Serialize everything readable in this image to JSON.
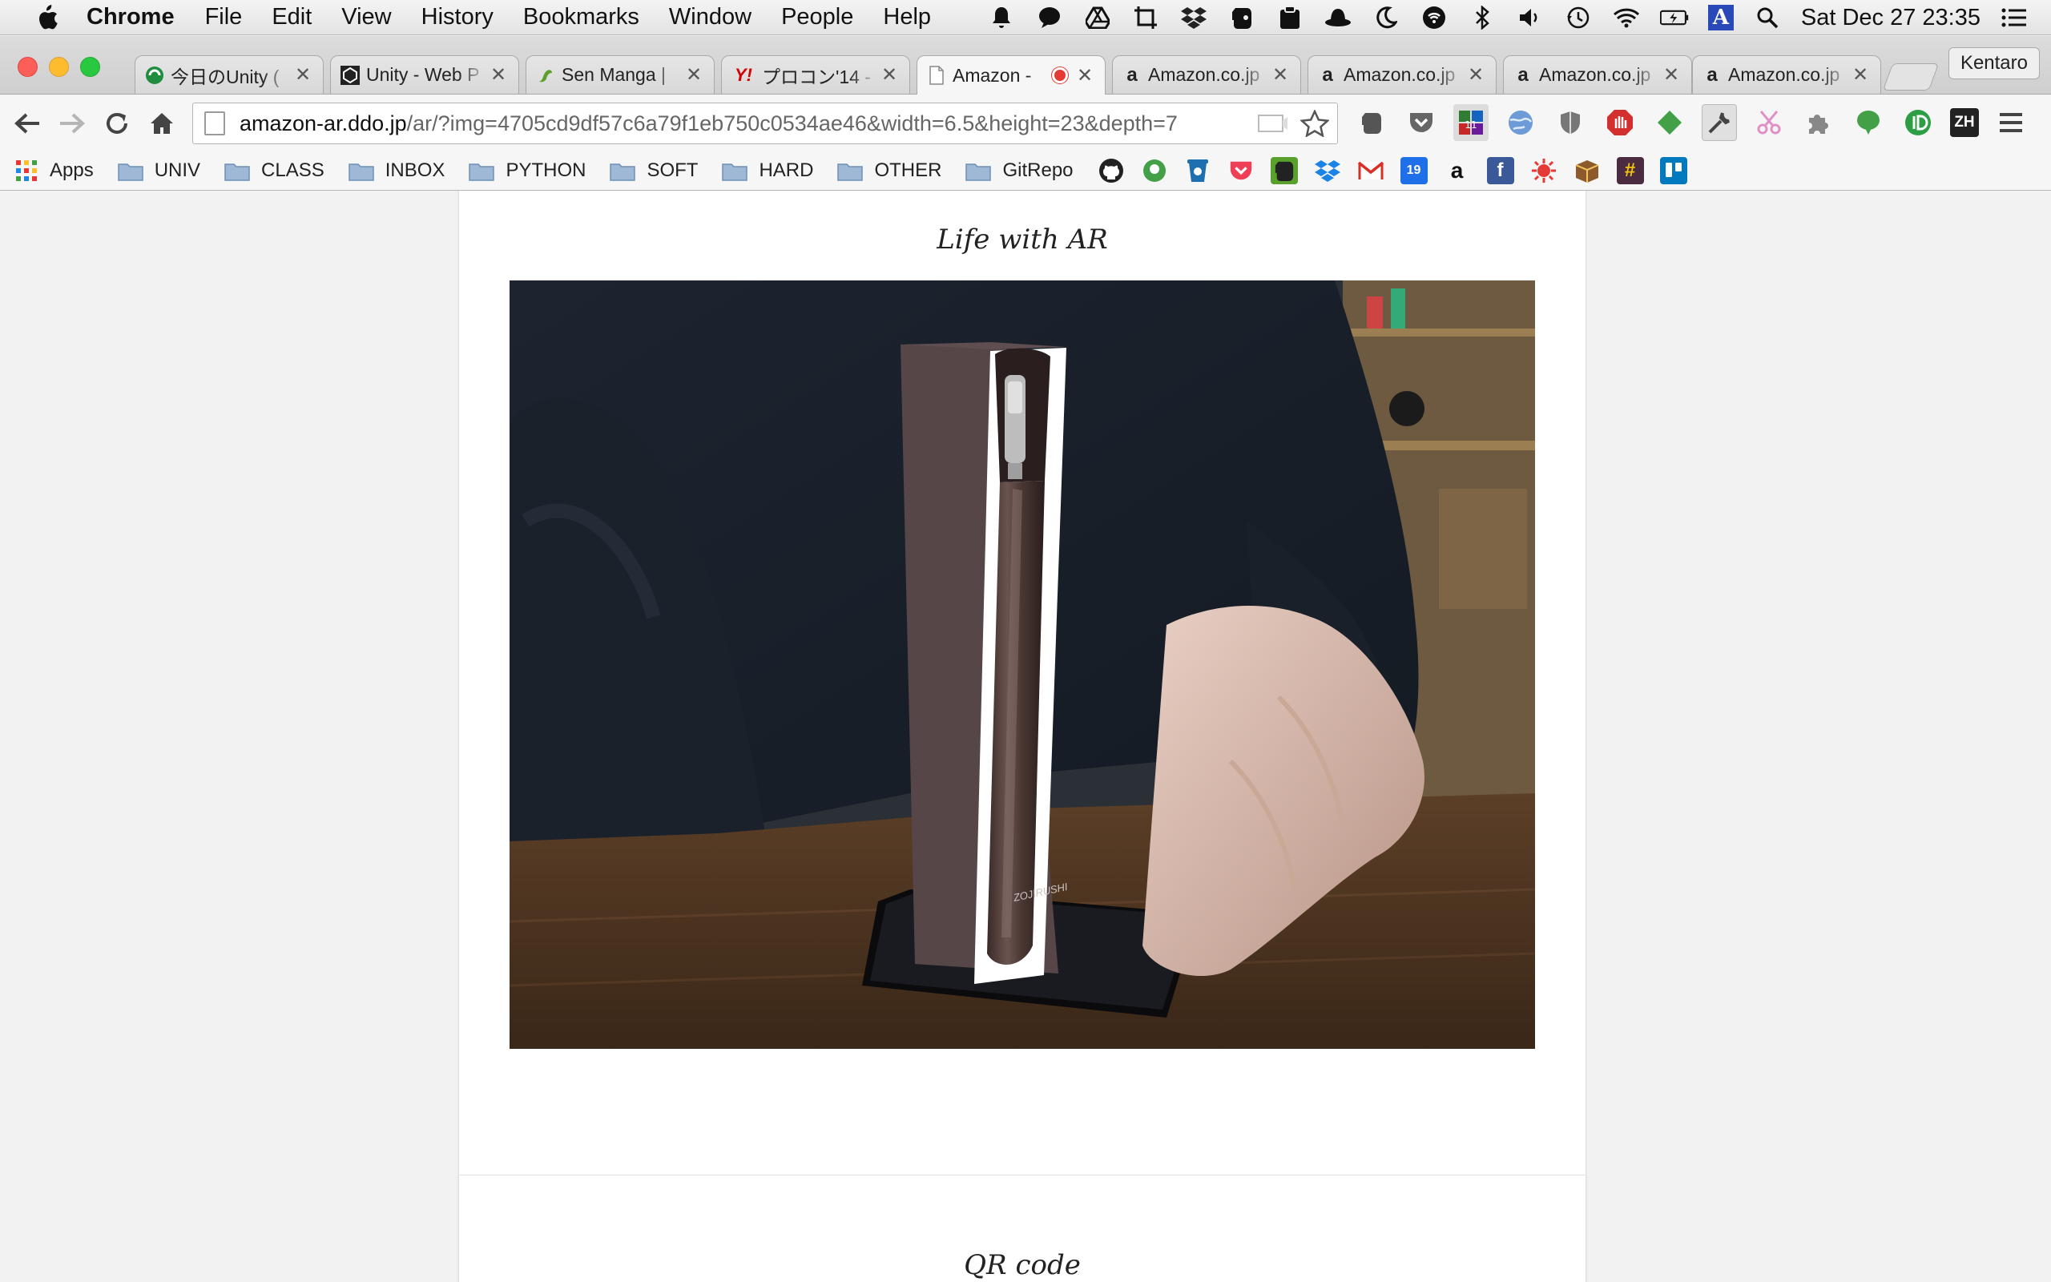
{
  "menubar": {
    "app_name": "Chrome",
    "items": [
      "File",
      "Edit",
      "View",
      "History",
      "Bookmarks",
      "Window",
      "People",
      "Help"
    ],
    "clock": "Sat Dec 27  23:35",
    "input_source": "A"
  },
  "tabs": [
    {
      "title": "今日のUnity (",
      "favicon": "unity-green-icon"
    },
    {
      "title": "Unity - Web P",
      "favicon": "unity-icon"
    },
    {
      "title": "Sen Manga |",
      "favicon": "senmanga-icon"
    },
    {
      "title": "プロコン'14 -",
      "favicon": "yahoo-icon"
    },
    {
      "title": "Amazon -",
      "favicon": "page-icon",
      "active": true,
      "recording": true
    },
    {
      "title": "Amazon.co.jp",
      "favicon": "amazon-icon"
    },
    {
      "title": "Amazon.co.jp",
      "favicon": "amazon-icon"
    },
    {
      "title": "Amazon.co.jp",
      "favicon": "amazon-icon"
    },
    {
      "title": "Amazon.co.jp",
      "favicon": "amazon-icon"
    }
  ],
  "profile_name": "Kentaro",
  "toolbar": {
    "url_host": "amazon-ar.ddo.jp",
    "url_rest": "/ar/?img=4705cd9df57c6a79f1eb750c0534ae46&width=6.5&height=23&depth=7"
  },
  "bookmarks": {
    "apps_label": "Apps",
    "folders": [
      "UNIV",
      "CLASS",
      "INBOX",
      "PYTHON",
      "SOFT",
      "HARD",
      "OTHER",
      "GitRepo"
    ]
  },
  "page": {
    "section1_title": "Life with AR",
    "section2_title": "QR code",
    "product_brand": "ZOJIRUSHI"
  },
  "colors": {
    "accent_red": "#e53935",
    "product_body": "#564648",
    "page_bg": "#f2f2f2"
  }
}
